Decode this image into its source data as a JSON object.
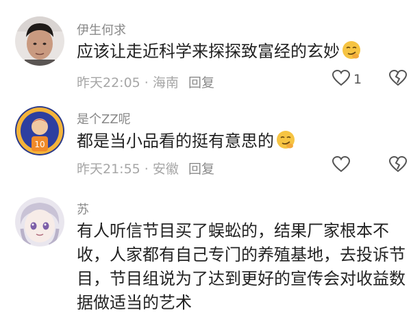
{
  "comments": [
    {
      "username": "伊生何求",
      "text": "应该让走近科学来探探致富经的玄妙",
      "emoji": "smirk-face-emoji",
      "time": "昨天22:05",
      "location": "海南",
      "reply_label": "回复",
      "like_count": "1"
    },
    {
      "username": "是个ZZ呢",
      "text": "都是当小品看的挺有意思的",
      "emoji": "smirk-face-emoji",
      "time": "昨天21:55",
      "location": "安徽",
      "reply_label": "回复",
      "like_count": ""
    },
    {
      "username": "苏",
      "text": "有人听信节目买了蜈蚣的，结果厂家根本不收，人家都有自己专门的养殖基地，去投诉节目，节目组说为了达到更好的宣传会对收益数据做适当的艺术"
    }
  ],
  "separator": " · ",
  "colors": {
    "meta_text": "#a6a6a6",
    "username": "#888888",
    "body_text": "#222222"
  }
}
